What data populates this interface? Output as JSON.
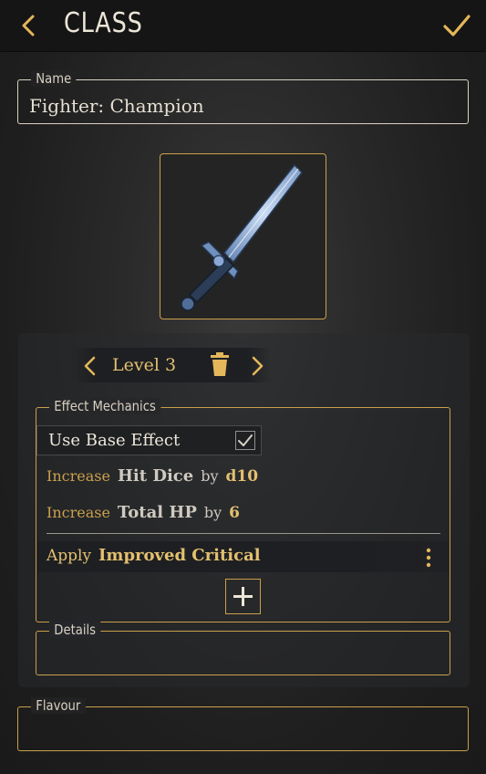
{
  "header": {
    "title": "CLASS",
    "back_icon": "chevron-left-icon",
    "confirm_icon": "checkmark-icon"
  },
  "name_field": {
    "label": "Name",
    "value": "Fighter: Champion"
  },
  "image": {
    "icon": "sword-icon"
  },
  "level_selector": {
    "label": "Level 3",
    "prev_icon": "chevron-left-icon",
    "delete_icon": "trash-icon",
    "next_icon": "chevron-right-icon"
  },
  "effect_mechanics": {
    "label": "Effect Mechanics",
    "use_base_effect": {
      "label": "Use Base Effect",
      "checked": true
    },
    "effects": [
      {
        "verb": "Increase",
        "target": "Hit Dice",
        "by": "by",
        "value": "d10"
      },
      {
        "verb": "Increase",
        "target": "Total HP",
        "by": "by",
        "value": "6"
      }
    ],
    "apply": {
      "verb": "Apply",
      "target": "Improved Critical",
      "menu_icon": "more-vertical-icon"
    },
    "add_icon": "plus-icon"
  },
  "details_field": {
    "label": "Details",
    "value": ""
  },
  "flavour_field": {
    "label": "Flavour",
    "value": ""
  },
  "colors": {
    "accent": "#c9a04b",
    "accent_text": "#e3c070",
    "background": "#1d1d1d",
    "text": "#e8e2d6"
  }
}
